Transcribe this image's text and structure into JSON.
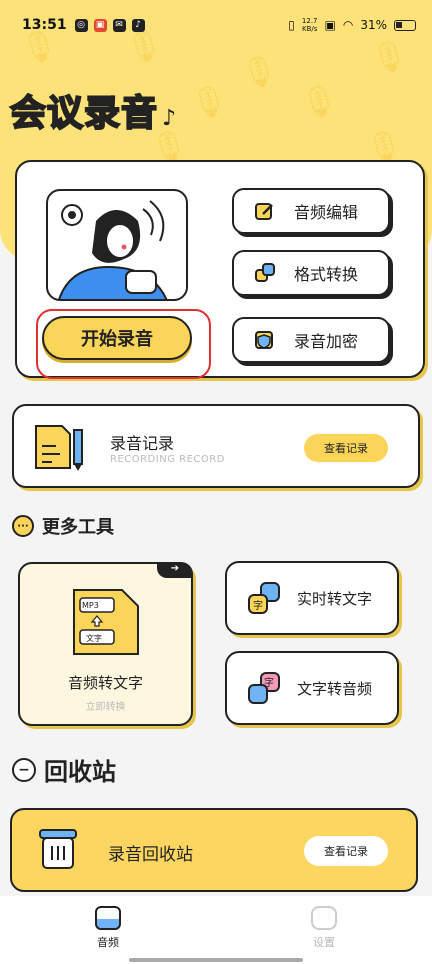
{
  "status_bar": {
    "time": "13:51",
    "net_speed_value": "12.7",
    "net_speed_unit": "KB/s",
    "battery": "31%"
  },
  "header": {
    "app_title": "会议录音"
  },
  "main_card": {
    "start_label": "开始录音",
    "buttons": [
      {
        "label": "音频编辑",
        "icon": "edit-icon"
      },
      {
        "label": "格式转换",
        "icon": "convert-icon"
      },
      {
        "label": "录音加密",
        "icon": "shield-icon"
      }
    ]
  },
  "record_card": {
    "title": "录音记录",
    "subtitle": "RECORDING RECORD",
    "view_label": "查看记录"
  },
  "more_tools": {
    "heading": "更多工具",
    "big_tool": {
      "label": "音频转文字",
      "sub": "立即转换",
      "file_tag_top": "MP3",
      "file_tag_bottom": "文字"
    },
    "small_tools": [
      {
        "label": "实时转文字",
        "icon": "realtime-transcribe-icon"
      },
      {
        "label": "文字转音频",
        "icon": "text-to-audio-icon"
      }
    ]
  },
  "recycle": {
    "heading": "回收站",
    "card_title": "录音回收站",
    "view_label": "查看记录"
  },
  "bottom_nav": [
    {
      "label": "音频",
      "active": true
    },
    {
      "label": "设置",
      "active": false
    }
  ],
  "colors": {
    "accent": "#fbd45a",
    "hero": "#fde27a",
    "highlight": "#e0302f"
  }
}
